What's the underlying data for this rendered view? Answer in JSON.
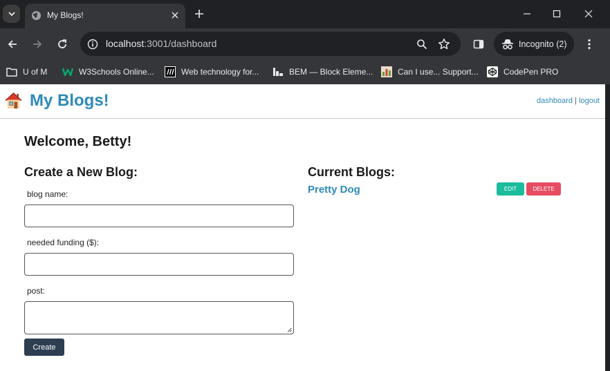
{
  "browser": {
    "tab_title": "My Blogs!",
    "url_host": "localhost",
    "url_rest": ":3001/dashboard",
    "profile_label": "Incognito (2)",
    "bookmarks": [
      {
        "label": "U of M",
        "icon": "folder-icon"
      },
      {
        "label": "W3Schools Online...",
        "icon": "w3schools-icon"
      },
      {
        "label": "Web technology for...",
        "icon": "mdn-icon"
      },
      {
        "label": "BEM — Block Eleme...",
        "icon": "bem-icon"
      },
      {
        "label": "Can I use... Support...",
        "icon": "caniuse-icon"
      },
      {
        "label": "CodePen PRO",
        "icon": "codepen-icon"
      }
    ]
  },
  "header": {
    "title": "My Blogs!",
    "dashboard_link": "dashboard",
    "separator": "|",
    "logout_link": "logout"
  },
  "main": {
    "welcome": "Welcome, Betty!",
    "create": {
      "heading": "Create a New Blog:",
      "name_label": "blog name:",
      "name_value": "",
      "funding_label": "needed funding ($):",
      "funding_value": "",
      "post_label": "post:",
      "post_value": "",
      "submit_label": "Create"
    },
    "current": {
      "heading": "Current Blogs:",
      "blogs": [
        {
          "title": "Pretty Dog",
          "edit_label": "EDIT",
          "delete_label": "DELETE"
        }
      ]
    }
  },
  "colors": {
    "brand": "#2e8ab8",
    "edit": "#1abc9c",
    "delete": "#e74c63",
    "create_button": "#2c3e50"
  }
}
